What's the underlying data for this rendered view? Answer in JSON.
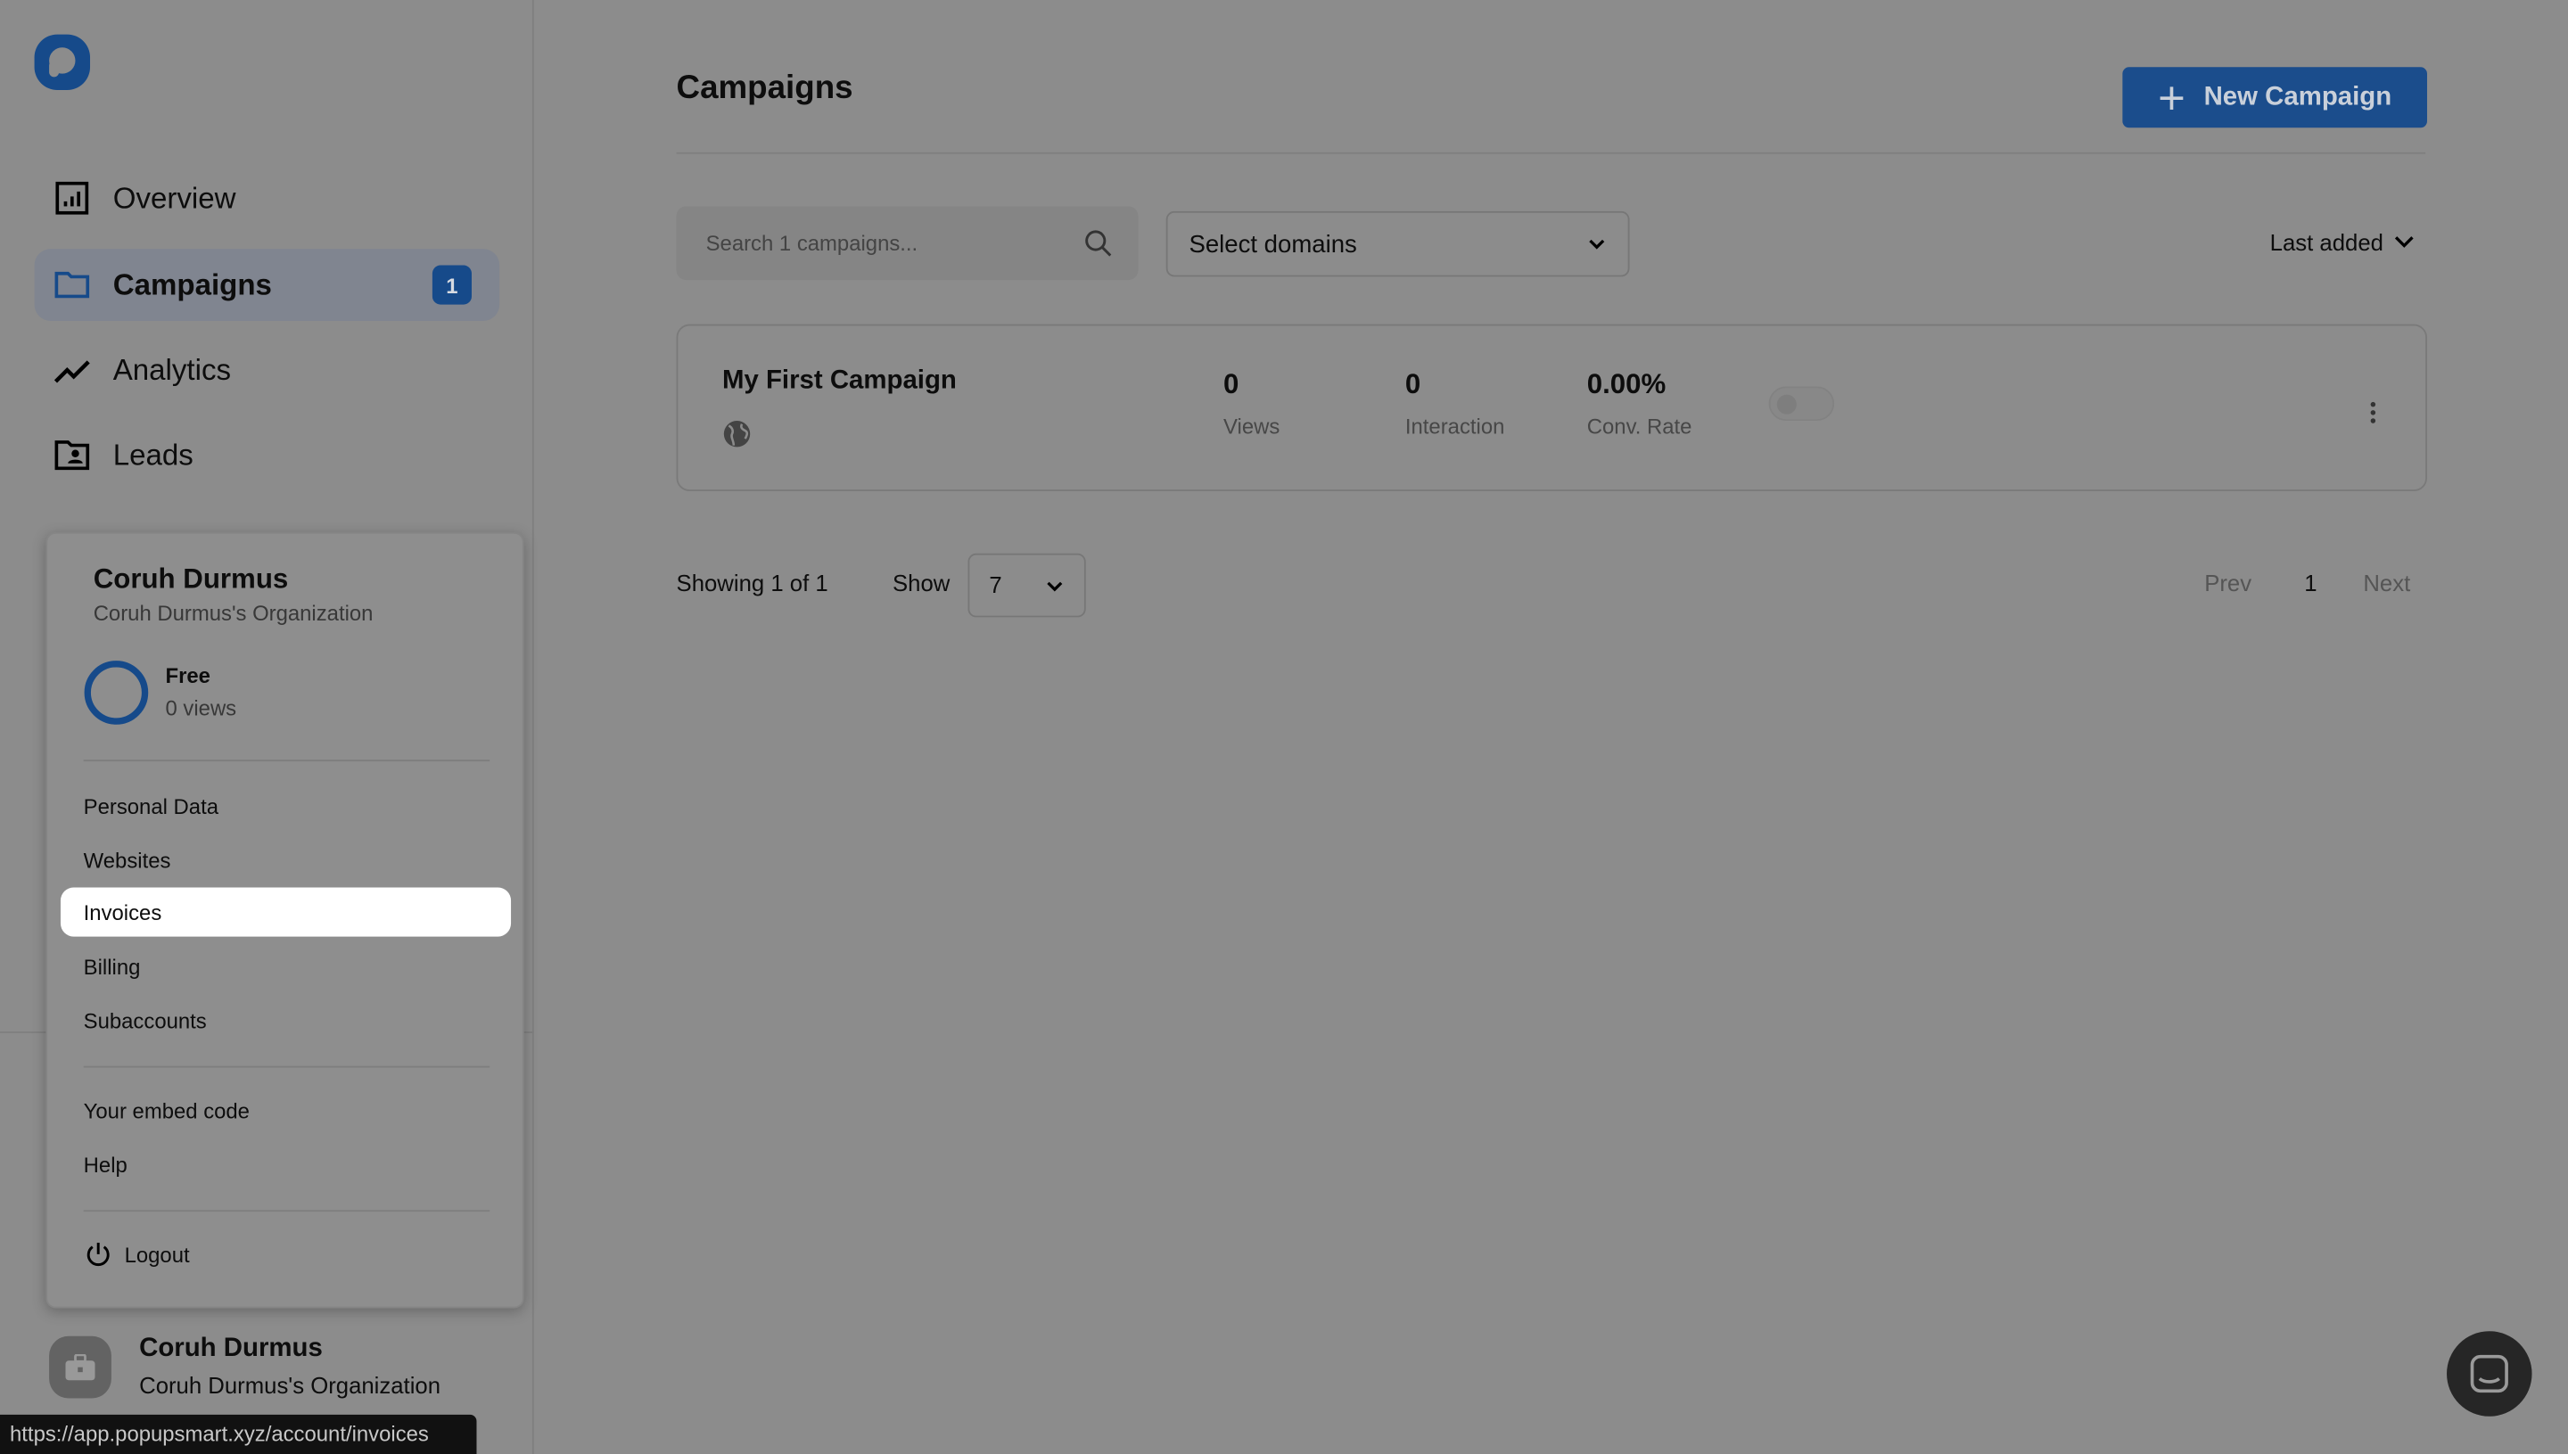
{
  "sidebar": {
    "items": [
      {
        "label": "Overview",
        "icon": "bar-chart-icon"
      },
      {
        "label": "Campaigns",
        "icon": "folder-icon",
        "badge": "1",
        "active": true
      },
      {
        "label": "Analytics",
        "icon": "trend-line-icon"
      },
      {
        "label": "Leads",
        "icon": "contact-folder-icon"
      }
    ],
    "user": {
      "name": "Coruh Durmus",
      "org": "Coruh Durmus's Organization"
    }
  },
  "account_menu": {
    "name": "Coruh Durmus",
    "org": "Coruh Durmus's Organization",
    "plan": "Free",
    "plan_usage": "0 views",
    "items": [
      "Personal Data",
      "Websites",
      "Invoices",
      "Billing",
      "Subaccounts"
    ],
    "items2": [
      "Your embed code",
      "Help"
    ],
    "logout": "Logout",
    "highlighted": "Invoices"
  },
  "status_url": "https://app.popupsmart.xyz/account/invoices",
  "main": {
    "title": "Campaigns",
    "new_campaign": "New Campaign",
    "search_placeholder": "Search 1 campaigns...",
    "domains_select": "Select domains",
    "sort": "Last added",
    "campaign": {
      "name": "My First Campaign",
      "stats": [
        {
          "value": "0",
          "label": "Views"
        },
        {
          "value": "0",
          "label": "Interaction"
        },
        {
          "value": "0.00%",
          "label": "Conv. Rate"
        }
      ],
      "enabled": false
    },
    "showing": "Showing 1 of 1",
    "show_label": "Show",
    "page_size": "7",
    "prev": "Prev",
    "page": "1",
    "next": "Next"
  },
  "colors": {
    "brand": "#164a8a",
    "overlay": "#8c8c8c"
  }
}
